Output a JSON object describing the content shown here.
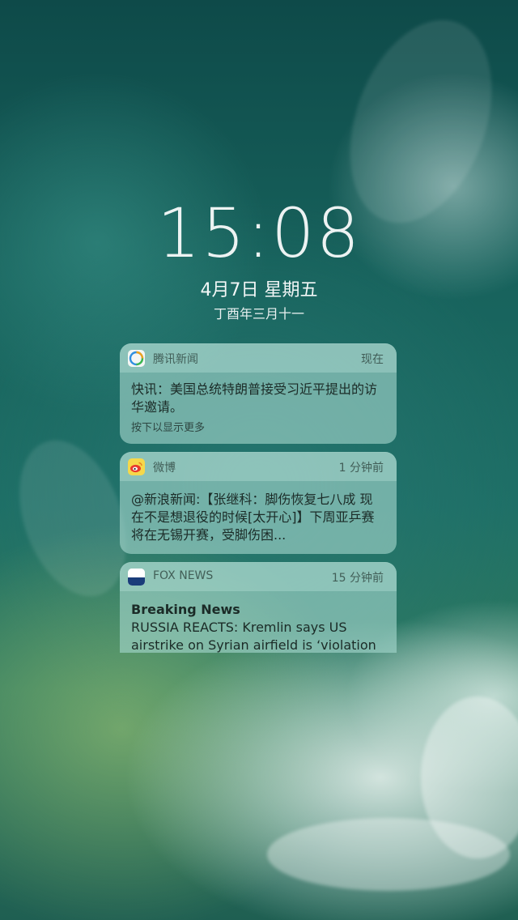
{
  "lockscreen": {
    "time": "15:08",
    "date": "4月7日 星期五",
    "lunar_date": "丁酉年三月十一"
  },
  "notifications": [
    {
      "app": "腾讯新闻",
      "icon": "tencent-news-icon",
      "time": "现在",
      "message": "快讯：美国总统特朗普接受习近平提出的访华邀请。",
      "more": "按下以显示更多"
    },
    {
      "app": "微博",
      "icon": "weibo-icon",
      "time": "1 分钟前",
      "message": "@新浪新闻:【张继科：脚伤恢复七八成 现在不是想退役的时候[太开心]】下周亚乒赛将在无锡开赛，受脚伤困..."
    },
    {
      "app": "FOX NEWS",
      "icon": "fox-news-icon",
      "icon_text": "FOX NEWS",
      "time": "15 分钟前",
      "title": "Breaking News",
      "message": "RUSSIA REACTS: Kremlin says US airstrike on Syrian airfield is ‘violation of"
    }
  ],
  "colors": {
    "notification_bg": "#a5d7cd",
    "text_dark": "#1b2b27",
    "weibo_yellow": "#f6d84a",
    "fox_blue": "#1a3d7a"
  }
}
